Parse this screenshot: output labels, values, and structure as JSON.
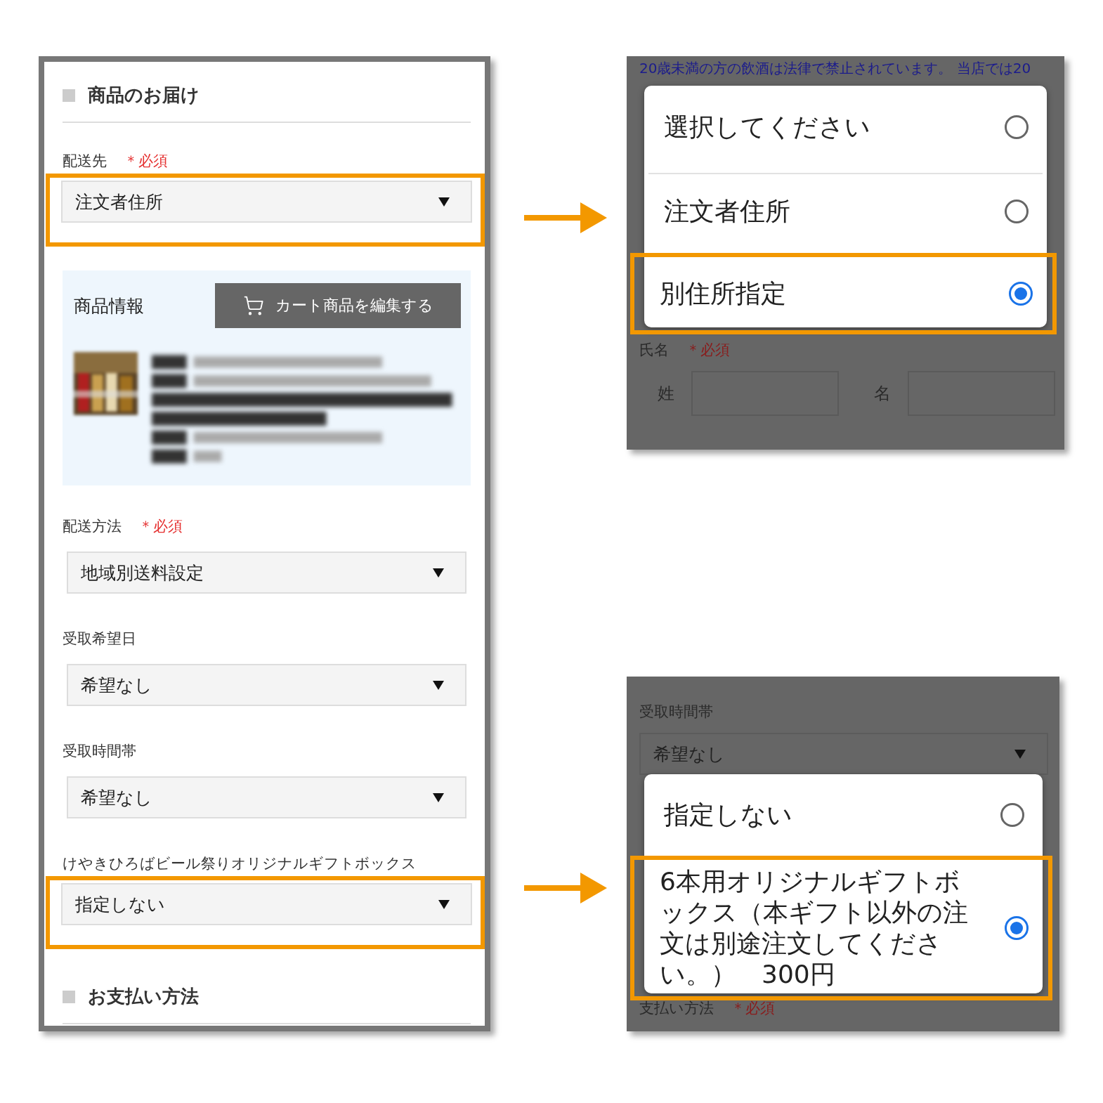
{
  "form": {
    "section_title": "商品のお届け",
    "fields": [
      {
        "kind": "select",
        "label": "配送先",
        "required": "＊必須",
        "value": "注文者住所",
        "highlighted": true
      },
      {
        "kind": "product",
        "title": "商品情報",
        "button": "カート商品を編集する"
      },
      {
        "kind": "select",
        "label": "配送方法",
        "required": "＊必須",
        "value": "地域別送料設定",
        "highlighted": false
      },
      {
        "kind": "select",
        "label": "受取希望日",
        "value": "希望なし",
        "highlighted": false
      },
      {
        "kind": "select",
        "label": "受取時間帯",
        "value": "希望なし",
        "highlighted": false
      },
      {
        "kind": "select",
        "label": "けやきひろばビール祭りオリジナルギフトボックス",
        "value": "指定しない",
        "highlighted": true
      }
    ],
    "payment_title": "お支払い方法"
  },
  "address_dialog": {
    "notice": [
      "20歳未満の方の飲酒は法律で禁止されています。 当店では20"
    ],
    "options": [
      {
        "label": "選択してください",
        "selected": false
      },
      {
        "label": "注文者住所",
        "selected": false
      },
      {
        "label": "別住所指定",
        "selected": true
      }
    ],
    "name_label": "氏名",
    "name_required": "＊必須",
    "name_parts": [
      "姓",
      "名"
    ]
  },
  "gift_dialog": {
    "label": "受取時間帯",
    "value": "希望なし",
    "options": [
      {
        "label": "指定しない",
        "selected": false
      },
      {
        "label": "6本用オリジナルギフトボックス（本ギフト以外の注文は別途注文してください。）　300円",
        "selected": true
      }
    ],
    "payment_label": "支払い方法",
    "payment_required": "＊必須"
  }
}
